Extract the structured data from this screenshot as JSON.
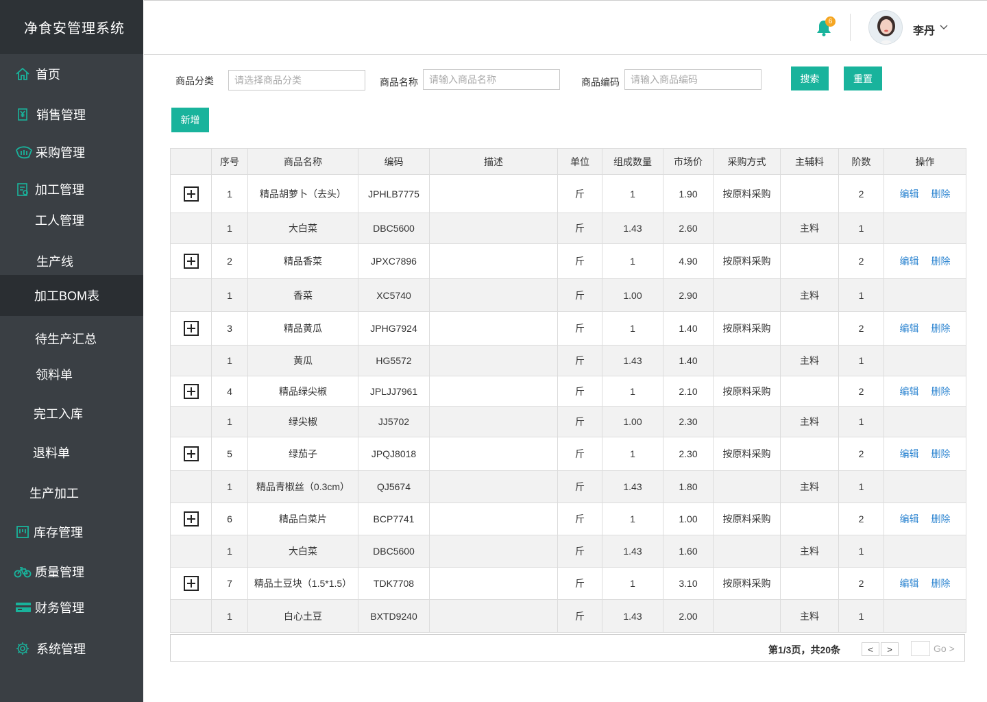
{
  "app": {
    "title": "净食安管理系统"
  },
  "sidebar": {
    "items": [
      {
        "label": "首页",
        "icon": "home-icon"
      },
      {
        "label": "销售管理",
        "icon": "yen-doc-icon"
      },
      {
        "label": "采购管理",
        "icon": "hand-icon"
      },
      {
        "label": "加工管理",
        "icon": "clipboard-icon"
      },
      {
        "label": "工人管理"
      },
      {
        "label": "生产线"
      },
      {
        "label": "加工BOM表",
        "active": true
      },
      {
        "label": "待生产汇总"
      },
      {
        "label": "领料单"
      },
      {
        "label": "完工入库"
      },
      {
        "label": "退料单"
      },
      {
        "label": "生产加工"
      },
      {
        "label": "库存管理",
        "icon": "warehouse-icon"
      },
      {
        "label": "质量管理",
        "icon": "bicycle-icon"
      },
      {
        "label": "财务管理",
        "icon": "card-icon"
      },
      {
        "label": "系统管理",
        "icon": "gear-icon"
      }
    ],
    "accent": "#19b39c"
  },
  "header": {
    "notification_count": "6",
    "user_name": "李丹"
  },
  "filters": {
    "category_label": "商品分类",
    "category_placeholder": "请选择商品分类",
    "name_label": "商品名称",
    "name_placeholder": "请输入商品名称",
    "code_label": "商品编码",
    "code_placeholder": "请输入商品编码",
    "search_label": "搜索",
    "reset_label": "重置"
  },
  "toolbar": {
    "add_label": "新增"
  },
  "table": {
    "columns": [
      "",
      "序号",
      "商品名称",
      "编码",
      "描述",
      "单位",
      "组成数量",
      "市场价",
      "采购方式",
      "主辅料",
      "阶数",
      "操作"
    ],
    "edit_label": "编辑",
    "delete_label": "删除",
    "rows": [
      {
        "type": "parent",
        "seq": "1",
        "name": "精品胡萝卜（去头）",
        "code": "JPHLB7775",
        "desc": "",
        "unit": "斤",
        "qty": "1",
        "price": "1.90",
        "method": "按原料采购",
        "material": "",
        "level": "2"
      },
      {
        "type": "child",
        "seq": "1",
        "name": "大白菜",
        "code": "DBC5600",
        "desc": "",
        "unit": "斤",
        "qty": "1.43",
        "price": "2.60",
        "method": "",
        "material": "主料",
        "level": "1"
      },
      {
        "type": "parent",
        "seq": "2",
        "name": "精品香菜",
        "code": "JPXC7896",
        "desc": "",
        "unit": "斤",
        "qty": "1",
        "price": "4.90",
        "method": "按原料采购",
        "material": "",
        "level": "2"
      },
      {
        "type": "child",
        "seq": "1",
        "name": "香菜",
        "code": "XC5740",
        "desc": "",
        "unit": "斤",
        "qty": "1.00",
        "price": "2.90",
        "method": "",
        "material": "主料",
        "level": "1"
      },
      {
        "type": "parent",
        "seq": "3",
        "name": "精品黄瓜",
        "code": "JPHG7924",
        "desc": "",
        "unit": "斤",
        "qty": "1",
        "price": "1.40",
        "method": "按原料采购",
        "material": "",
        "level": "2"
      },
      {
        "type": "child",
        "seq": "1",
        "name": "黄瓜",
        "code": "HG5572",
        "desc": "",
        "unit": "斤",
        "qty": "1.43",
        "price": "1.40",
        "method": "",
        "material": "主料",
        "level": "1"
      },
      {
        "type": "parent",
        "seq": "4",
        "name": "精品绿尖椒",
        "code": "JPLJJ7961",
        "desc": "",
        "unit": "斤",
        "qty": "1",
        "price": "2.10",
        "method": "按原料采购",
        "material": "",
        "level": "2"
      },
      {
        "type": "child",
        "seq": "1",
        "name": "绿尖椒",
        "code": "JJ5702",
        "desc": "",
        "unit": "斤",
        "qty": "1.00",
        "price": "2.30",
        "method": "",
        "material": "主料",
        "level": "1"
      },
      {
        "type": "parent",
        "seq": "5",
        "name": "绿茄子",
        "code": "JPQJ8018",
        "desc": "",
        "unit": "斤",
        "qty": "1",
        "price": "2.30",
        "method": "按原料采购",
        "material": "",
        "level": "2"
      },
      {
        "type": "child",
        "seq": "1",
        "name": "精品青椒丝（0.3cm）",
        "code": "QJ5674",
        "desc": "",
        "unit": "斤",
        "qty": "1.43",
        "price": "1.80",
        "method": "",
        "material": "主料",
        "level": "1"
      },
      {
        "type": "parent",
        "seq": "6",
        "name": "精品白菜片",
        "code": "BCP7741",
        "desc": "",
        "unit": "斤",
        "qty": "1",
        "price": "1.00",
        "method": "按原料采购",
        "material": "",
        "level": "2"
      },
      {
        "type": "child",
        "seq": "1",
        "name": "大白菜",
        "code": "DBC5600",
        "desc": "",
        "unit": "斤",
        "qty": "1.43",
        "price": "1.60",
        "method": "",
        "material": "主料",
        "level": "1"
      },
      {
        "type": "parent",
        "seq": "7",
        "name": "精品土豆块（1.5*1.5）",
        "code": "TDK7708",
        "desc": "",
        "unit": "斤",
        "qty": "1",
        "price": "3.10",
        "method": "按原料采购",
        "material": "",
        "level": "2"
      },
      {
        "type": "child",
        "seq": "1",
        "name": "白心土豆",
        "code": "BXTD9240",
        "desc": "",
        "unit": "斤",
        "qty": "1.43",
        "price": "2.00",
        "method": "",
        "material": "主料",
        "level": "1"
      }
    ]
  },
  "pagination": {
    "info": "第1/3页，共20条",
    "prev_label": "<",
    "next_label": ">",
    "go_label": "Go >"
  }
}
